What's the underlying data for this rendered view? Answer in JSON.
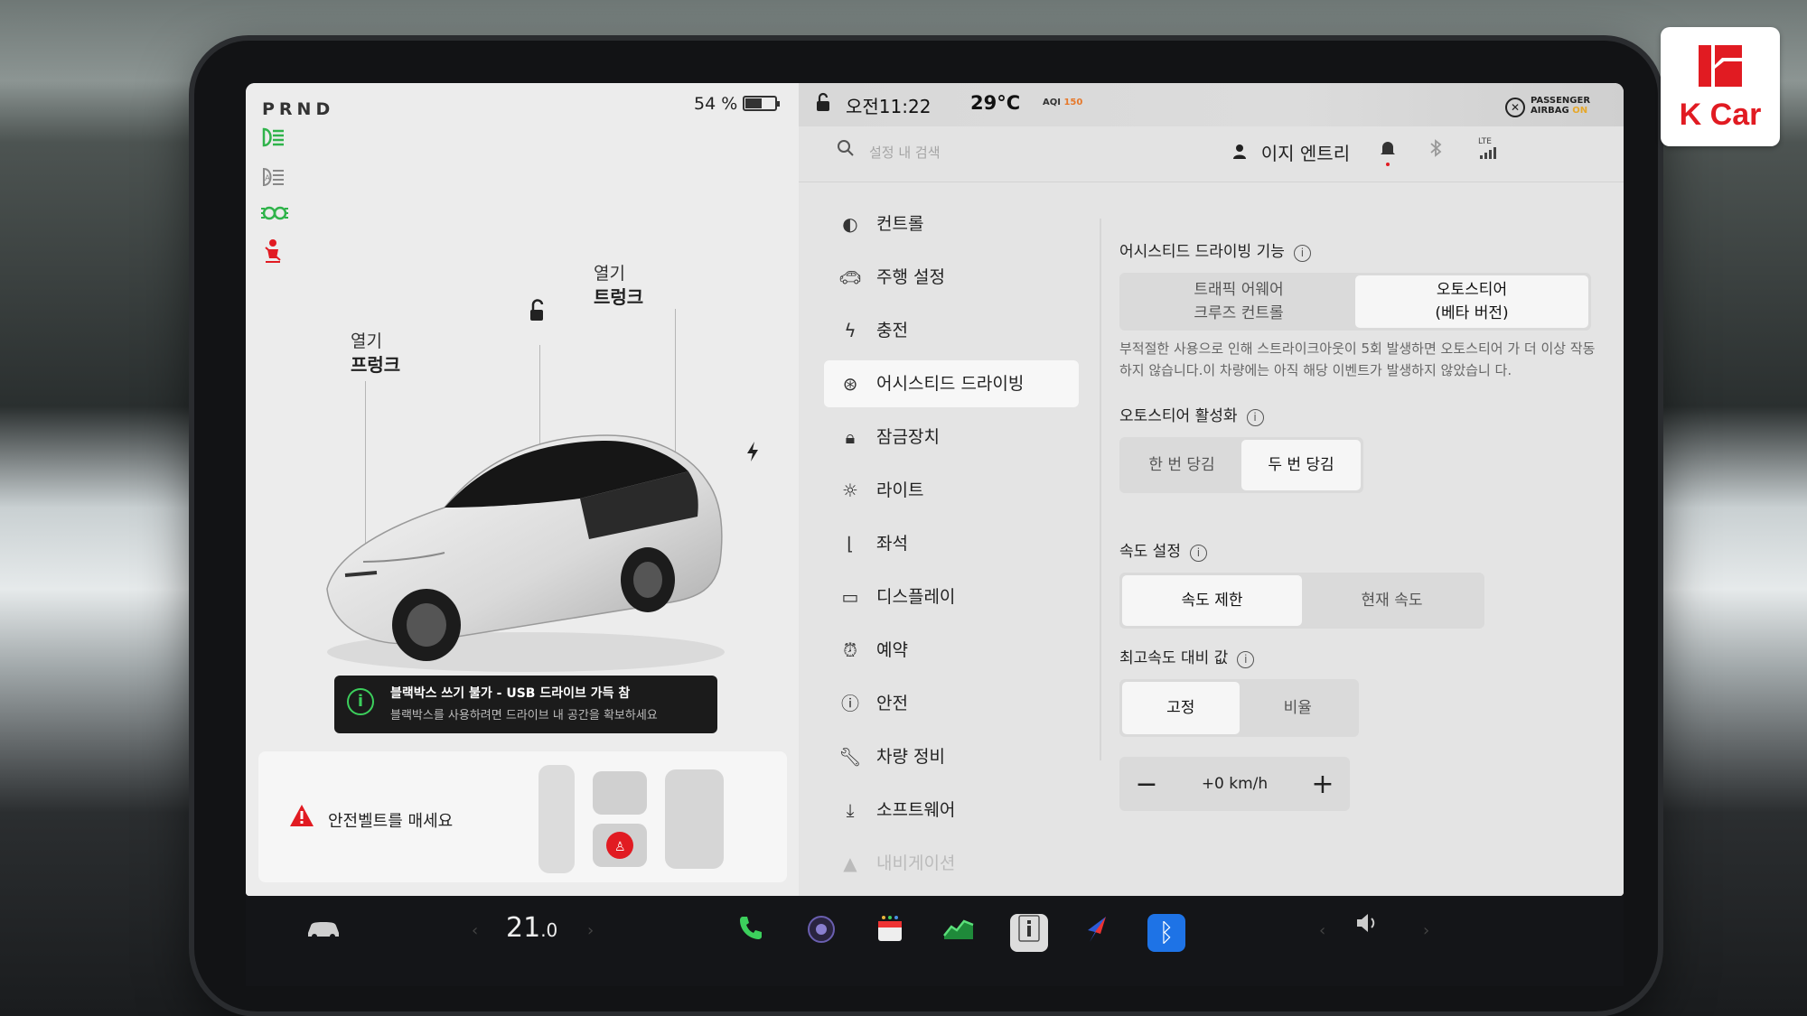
{
  "gear": "PRND",
  "battery": {
    "percent_label": "54 %",
    "level": 0.54
  },
  "left_panel": {
    "frunk": {
      "open_label": "열기",
      "name": "프렁크"
    },
    "trunk": {
      "open_label": "열기",
      "name": "트렁크"
    },
    "toast": {
      "title": "블랙박스 쓰기 불가 - USB 드라이브 가득 참",
      "subtitle": "블랙박스를 사용하려면 드라이브 내 공간을 확보하세요"
    },
    "seatbelt_warning": "안전벨트를 매세요"
  },
  "topbar": {
    "time": "오전11:22",
    "temperature": "29°C",
    "aqi_label": "AQI",
    "aqi_value": "150",
    "airbag_line1": "PASSENGER",
    "airbag_line2": "AIRBAG",
    "airbag_state": "ON"
  },
  "search": {
    "placeholder": "설정 내 검색"
  },
  "profile": {
    "name": "이지 엔트리"
  },
  "signal_label": "LTE",
  "menu": [
    {
      "label": "컨트롤",
      "icon": "toggle-icon"
    },
    {
      "label": "주행 설정",
      "icon": "car-icon"
    },
    {
      "label": "충전",
      "icon": "bolt-icon"
    },
    {
      "label": "어시스티드 드라이빙",
      "icon": "steering-wheel-icon"
    },
    {
      "label": "잠금장치",
      "icon": "lock-icon"
    },
    {
      "label": "라이트",
      "icon": "sun-icon"
    },
    {
      "label": "좌석",
      "icon": "seat-icon"
    },
    {
      "label": "디스플레이",
      "icon": "display-icon"
    },
    {
      "label": "예약",
      "icon": "alarm-icon"
    },
    {
      "label": "안전",
      "icon": "info-icon"
    },
    {
      "label": "차량 정비",
      "icon": "wrench-icon"
    },
    {
      "label": "소프트웨어",
      "icon": "download-icon"
    },
    {
      "label": "내비게이션",
      "icon": "navigation-icon"
    }
  ],
  "settings": {
    "assisted_driving": {
      "title": "어시스티드 드라이빙 기능",
      "option_a_line1": "트래픽 어웨어",
      "option_a_line2": "크루즈 컨트롤",
      "option_b_line1": "오토스티어",
      "option_b_line2": "(베타 버전)",
      "description": "부적절한 사용으로 인해 스트라이크아웃이 5회 발생하면 오토스티어 가 더 이상 작동하지 않습니다.이 차량에는 아직 해당 이벤트가 발생하지 않았습니 다."
    },
    "autosteer_activation": {
      "title": "오토스티어 활성화",
      "options": [
        "한 번 당김",
        "두 번 당김"
      ]
    },
    "speed_setting": {
      "title": "속도 설정",
      "options": [
        "속도 제한",
        "현재 속도"
      ]
    },
    "max_speed_offset": {
      "title": "최고속도 대비 값",
      "options": [
        "고정",
        "비율"
      ],
      "value": "+0 km/h",
      "minus": "−",
      "plus": "+"
    }
  },
  "dock": {
    "cabin_temp": "21",
    "cabin_temp_decimal": ".0",
    "bluetooth_glyph": "ᛒ"
  },
  "logo": {
    "name": "K Car"
  }
}
